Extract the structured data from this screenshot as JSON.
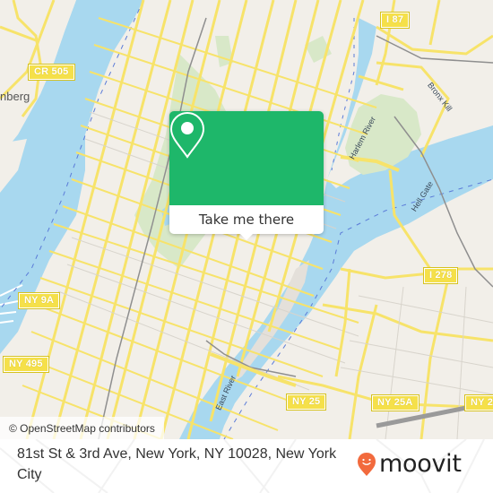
{
  "map": {
    "place_labels": [
      "nberg"
    ],
    "water_labels": {
      "harlem_river": "Harlem River",
      "bronx_kill": "Bronx Kill",
      "hell_gate": "Hell Gate",
      "east_river": "East River"
    },
    "road_shields": {
      "cr505": "CR 505",
      "i87": "I 87",
      "i278": "I 278",
      "ny9a": "NY 9A",
      "ny495": "NY 495",
      "ny25": "NY 25",
      "ny25a": "NY 25A"
    },
    "colors": {
      "land": "#f2efe9",
      "water": "#a8d8ef",
      "park": "#d8e8c8",
      "road": "#f7e36a",
      "accent": "#1eb76a"
    },
    "attribution": "© OpenStreetMap contributors"
  },
  "popup": {
    "icon": "map-pin-icon",
    "button_label": "Take me there"
  },
  "footer": {
    "address": "81st St & 3rd Ave, New York, NY 10028, New York City",
    "logo_text": "moovit",
    "logo_icon": "moovit-pin-icon",
    "logo_color": "#f26a3d"
  }
}
